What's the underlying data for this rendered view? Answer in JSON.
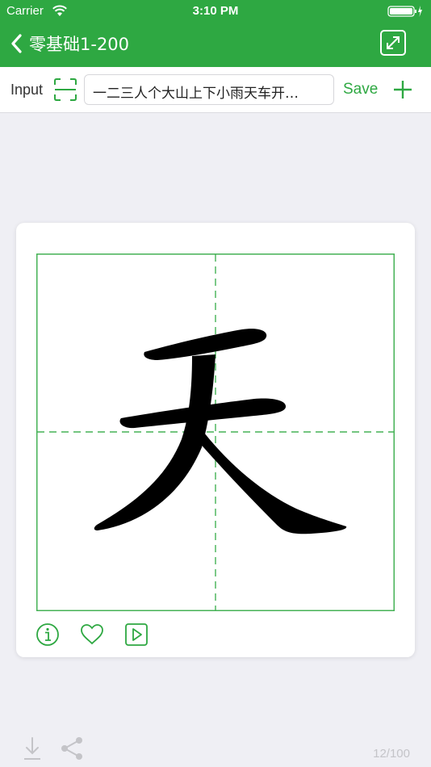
{
  "status_bar": {
    "carrier": "Carrier",
    "time": "3:10 PM"
  },
  "nav": {
    "title": "零基础1-200",
    "back_icon": "chevron-left-icon",
    "expand_icon": "expand-icon"
  },
  "input_bar": {
    "label": "Input",
    "scan_icon": "scan-icon",
    "text_value": "一二三人个大山上下小雨天车开…",
    "save_label": "Save",
    "add_icon": "plus-icon"
  },
  "card": {
    "character": "天",
    "actions": [
      "info-icon",
      "heart-icon",
      "play-icon"
    ]
  },
  "bottom": {
    "download_icon": "download-icon",
    "share_icon": "share-icon",
    "page_counter": "12/100"
  },
  "colors": {
    "accent": "#2ea842",
    "grid_line": "#45b256",
    "glyph": "#000000",
    "muted": "#c4c4c8"
  }
}
